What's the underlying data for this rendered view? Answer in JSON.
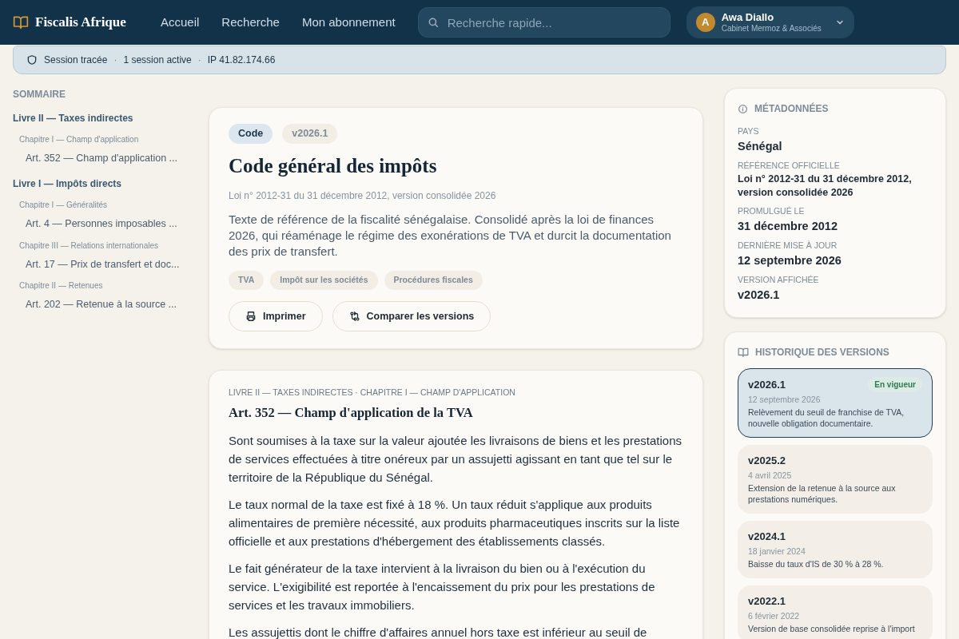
{
  "header": {
    "brand": "Fiscalis Afrique",
    "nav": [
      {
        "label": "Accueil"
      },
      {
        "label": "Recherche"
      },
      {
        "label": "Mon abonnement"
      }
    ],
    "search": {
      "placeholder": "Recherche rapide..."
    },
    "user": {
      "initial": "A",
      "name": "Awa Diallo",
      "org": "Cabinet Mermoz & Associés"
    }
  },
  "session_bar": {
    "separator": "·",
    "items": [
      "Session tracée",
      "1 session active",
      "IP 41.82.174.66"
    ]
  },
  "sidebar": {
    "title": "SOMMAIRE",
    "items": [
      {
        "label": "Livre II — Taxes indirectes",
        "children": [
          {
            "label": "Chapitre I — Champ d'application",
            "children": [
              {
                "label": "Art. 352 — Champ d'application ..."
              }
            ]
          }
        ]
      },
      {
        "label": "Livre I — Impôts directs",
        "children": [
          {
            "label": "Chapitre I — Généralités",
            "children": [
              {
                "label": "Art. 4 — Personnes imposables ..."
              }
            ]
          },
          {
            "label": "Chapitre III — Relations internationales",
            "children": [
              {
                "label": "Art. 17 — Prix de transfert et doc..."
              }
            ]
          },
          {
            "label": "Chapitre II — Retenues",
            "children": [
              {
                "label": "Art. 202 — Retenue à la source ..."
              }
            ]
          }
        ]
      }
    ]
  },
  "document": {
    "badges": [
      {
        "kind": "type",
        "label": "Code"
      },
      {
        "kind": "version",
        "label": "v2026.1"
      }
    ],
    "title": "Code général des impôts",
    "reference": "Loi n° 2012-31 du 31 décembre 2012, version consolidée 2026",
    "summary": "Texte de référence de la fiscalité sénégalaise. Consolidé après la loi de finances 2026, qui réaménage le régime des exonérations de TVA et durcit la documentation des prix de transfert.",
    "tags": [
      "TVA",
      "Impôt sur les sociétés",
      "Procédures fiscales"
    ],
    "actions": [
      {
        "kind": "print",
        "label": "Imprimer"
      },
      {
        "kind": "compare",
        "label": "Comparer les versions"
      }
    ]
  },
  "article": {
    "breadcrumb": "LIVRE II — TAXES INDIRECTES · CHAPITRE I — CHAMP D'APPLICATION",
    "title": "Art. 352 — Champ d'application de la TVA",
    "paragraphs": [
      "Sont soumises à la taxe sur la valeur ajoutée les livraisons de biens et les prestations de services effectuées à titre onéreux par un assujetti agissant en tant que tel sur le territoire de la République du Sénégal.",
      "Le taux normal de la taxe est fixé à 18 %. Un taux réduit s'applique aux produits alimentaires de première nécessité, aux produits pharmaceutiques inscrits sur la liste officielle et aux prestations d'hébergement des établissements classés.",
      "Le fait générateur de la taxe intervient à la livraison du bien ou à l'exécution du service. L'exigibilité est reportée à l'encaissement du prix pour les prestations de services et les travaux immobiliers.",
      "Les assujettis dont le chiffre d'affaires annuel hors taxe est inférieur au seuil de"
    ]
  },
  "metadata": {
    "title": "MÉTADONNÉES",
    "fields": [
      {
        "label": "PAYS",
        "value": "Sénégal",
        "kind": "large"
      },
      {
        "label": "RÉFÉRENCE OFFICIELLE",
        "value": "Loi n° 2012-31 du 31 décembre 2012, version consolidée 2026",
        "kind": "small"
      },
      {
        "label": "PROMULGUÉ LE",
        "value": "31 décembre 2012",
        "kind": "large"
      },
      {
        "label": "DERNIÈRE MISE À JOUR",
        "value": "12 septembre 2026",
        "kind": "large"
      },
      {
        "label": "VERSION AFFICHÉE",
        "value": "v2026.1",
        "kind": "large"
      }
    ]
  },
  "history": {
    "title": "HISTORIQUE DES VERSIONS",
    "versions": [
      {
        "version": "v2026.1",
        "selected": true,
        "badge": "En vigueur",
        "date": "12 septembre 2026",
        "note": "Relèvement du seuil de franchise de TVA, nouvelle obligation documentaire."
      },
      {
        "version": "v2025.2",
        "selected": false,
        "date": "4 avril 2025",
        "note": "Extension de la retenue à la source aux prestations numériques."
      },
      {
        "version": "v2024.1",
        "selected": false,
        "date": "18 janvier 2024",
        "note": "Baisse du taux d'IS de 30 % à 28 %."
      },
      {
        "version": "v2022.1",
        "selected": false,
        "date": "6 février 2022",
        "note": "Version de base consolidée reprise à l'import"
      }
    ]
  }
}
